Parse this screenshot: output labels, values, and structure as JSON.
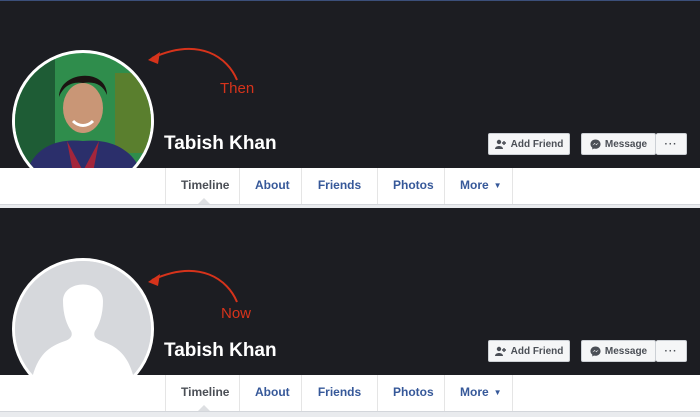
{
  "profile_then": {
    "annotation": "Then",
    "name": "Tabish Khan",
    "buttons": {
      "add_friend": "Add Friend",
      "message": "Message",
      "more": "···"
    },
    "tabs": [
      "Timeline",
      "About",
      "Friends",
      "Photos",
      "More"
    ]
  },
  "profile_now": {
    "annotation": "Now",
    "name": "Tabish Khan",
    "buttons": {
      "add_friend": "Add Friend",
      "message": "Message",
      "more": "···"
    },
    "tabs": [
      "Timeline",
      "About",
      "Friends",
      "Photos",
      "More"
    ]
  },
  "colors": {
    "cover": "#1c1d22",
    "annotation": "#d6331b",
    "tab_link": "#365899"
  },
  "icons": [
    "add-friend-icon",
    "messenger-icon",
    "caret-down-icon",
    "curved-arrow-icon",
    "default-avatar-icon"
  ]
}
